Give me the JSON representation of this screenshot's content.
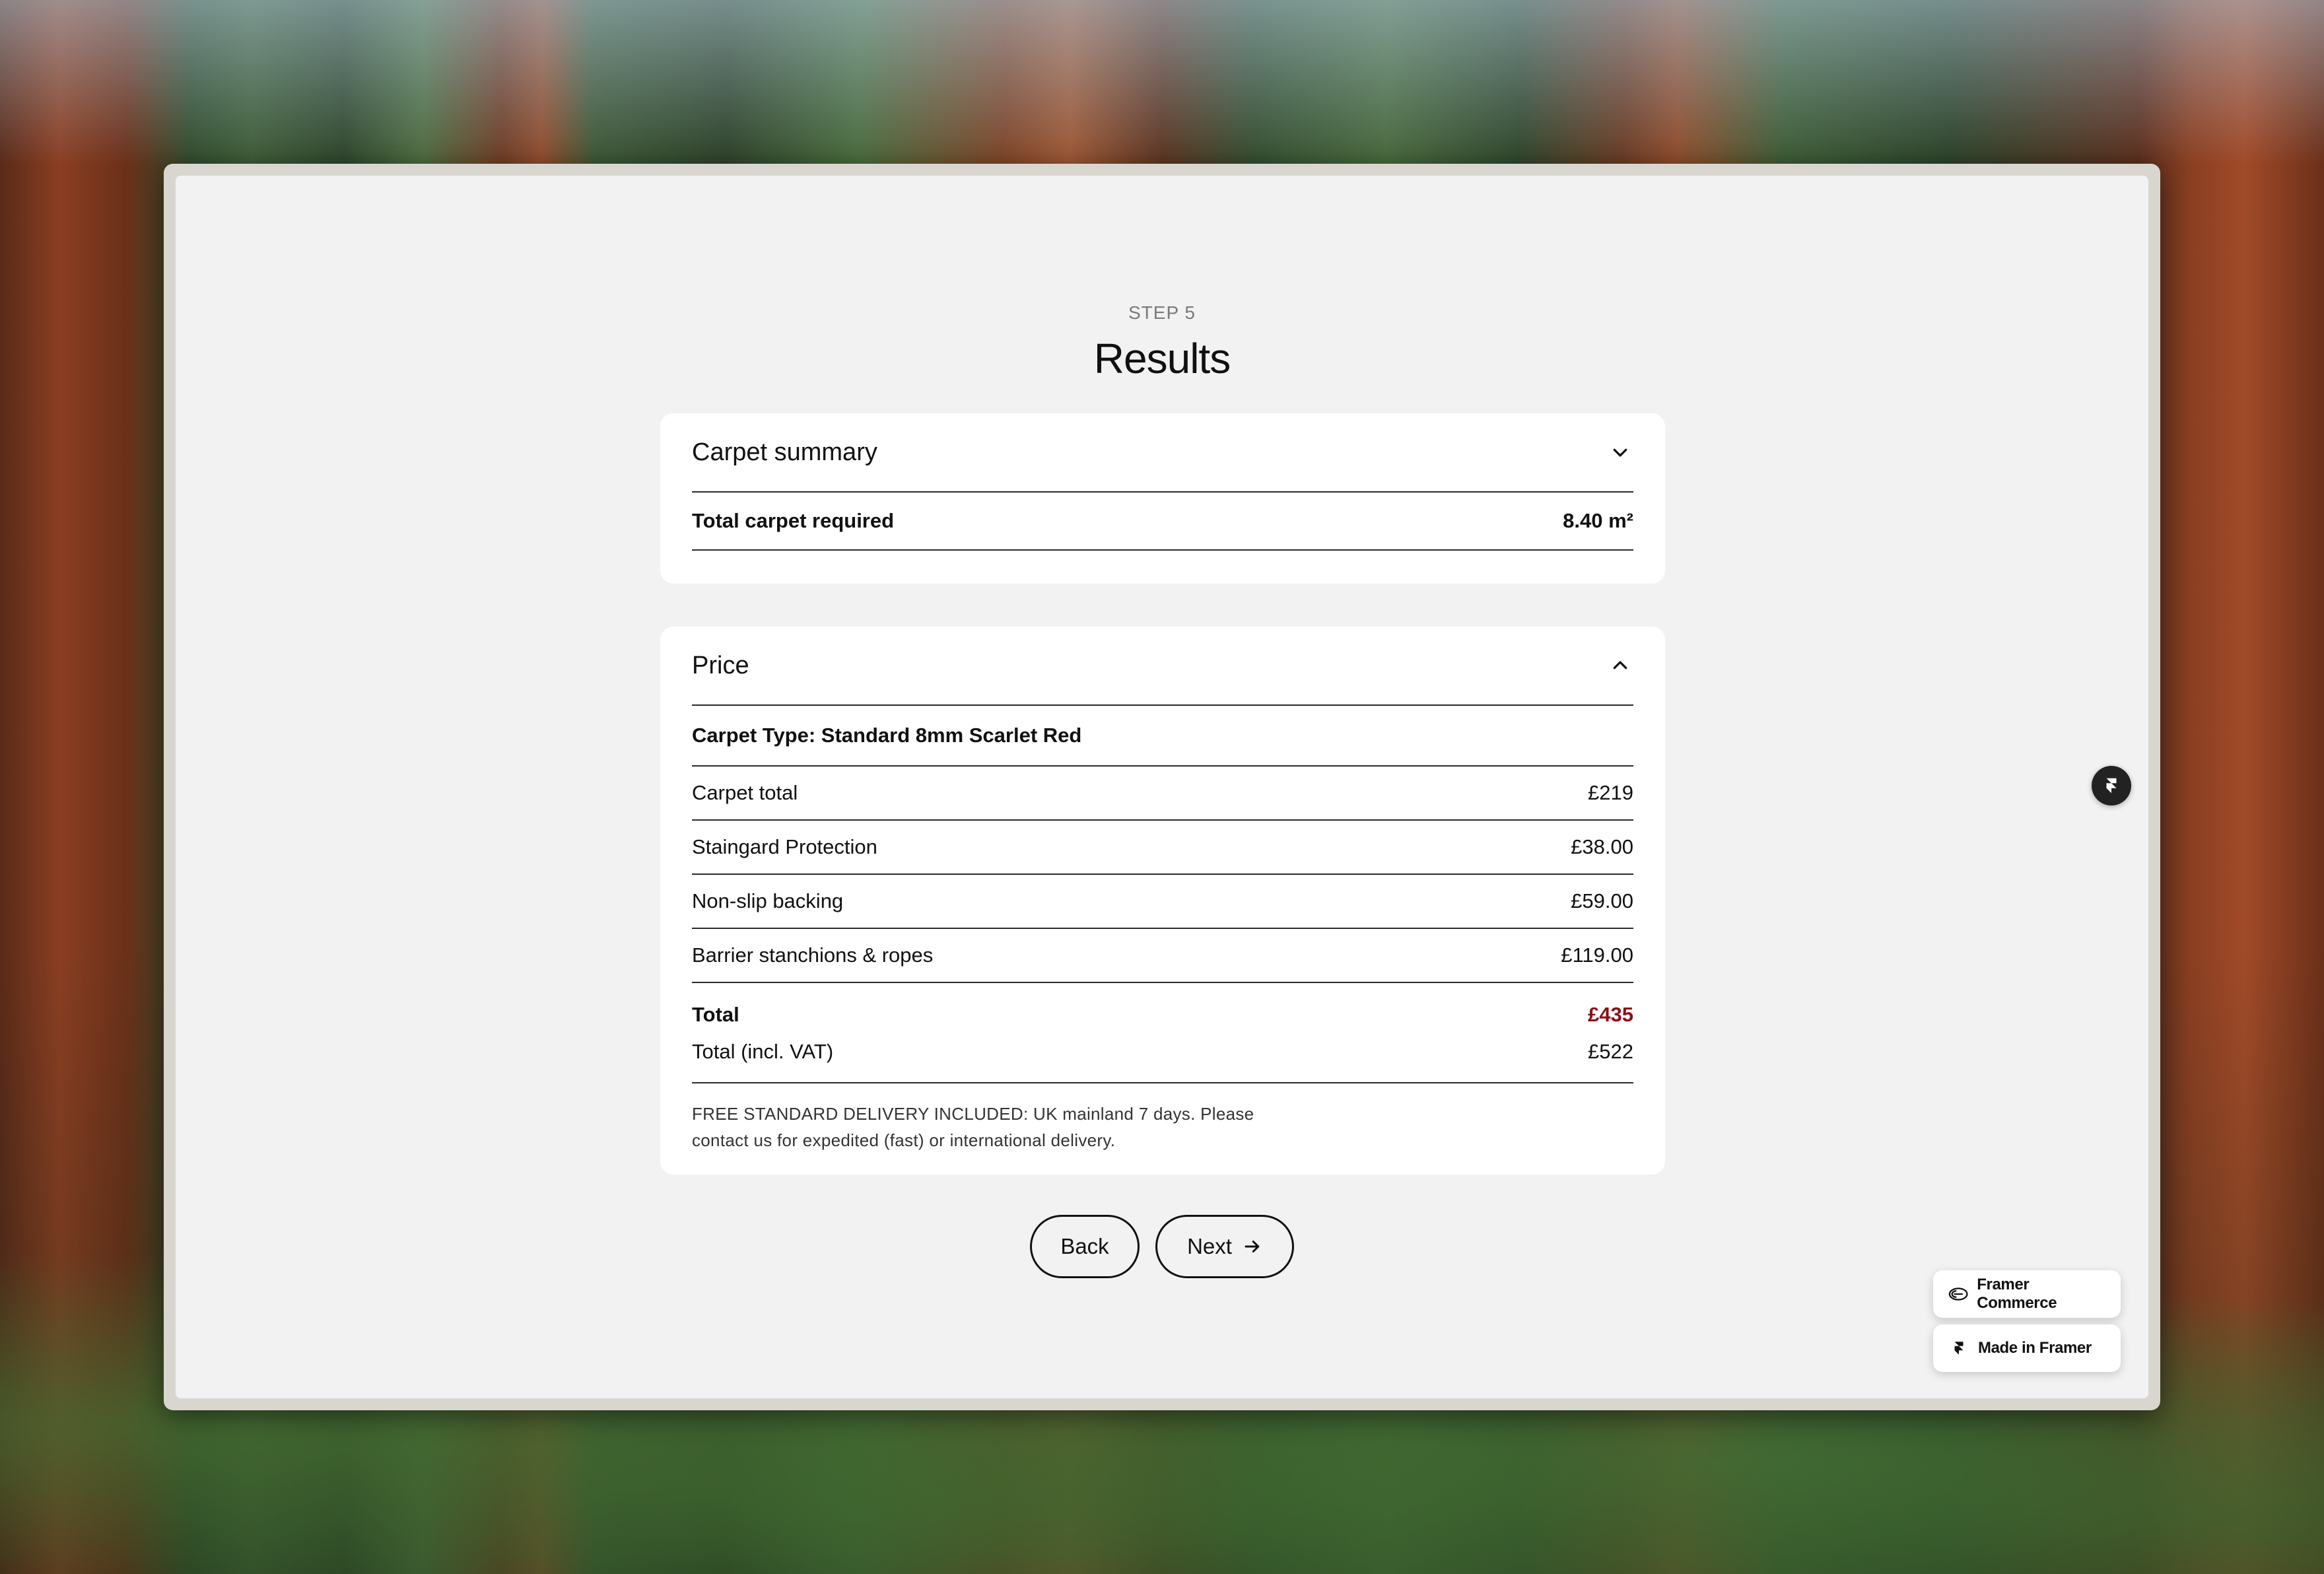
{
  "header": {
    "step": "STEP 5",
    "title": "Results"
  },
  "summary": {
    "title": "Carpet summary",
    "row_label": "Total carpet required",
    "row_value": "8.40 m²"
  },
  "price": {
    "title": "Price",
    "carpet_type": "Carpet Type: Standard 8mm Scarlet Red",
    "items": [
      {
        "label": "Carpet total",
        "value": "£219"
      },
      {
        "label": "Staingard Protection",
        "value": "£38.00"
      },
      {
        "label": "Non-slip backing",
        "value": "£59.00"
      },
      {
        "label": "Barrier stanchions & ropes",
        "value": "£119.00"
      }
    ],
    "total_label": "Total",
    "total_value": "£435",
    "vat_label": "Total (incl. VAT)",
    "vat_value": "£522",
    "note": "FREE STANDARD DELIVERY INCLUDED: UK mainland 7 days. Please contact us for expedited (fast) or international delivery."
  },
  "actions": {
    "back": "Back",
    "next": "Next"
  },
  "badges": {
    "commerce": "Framer Commerce",
    "made": "Made in Framer"
  },
  "icons": {
    "summary_toggle": "chevron-down-icon",
    "price_toggle": "chevron-up-icon",
    "next_arrow": "arrow-right-icon",
    "framer": "framer-logo-icon"
  },
  "colors": {
    "accent_total": "#8a0f17",
    "panel_bg": "#f2f2f2",
    "card_bg": "#ffffff"
  }
}
